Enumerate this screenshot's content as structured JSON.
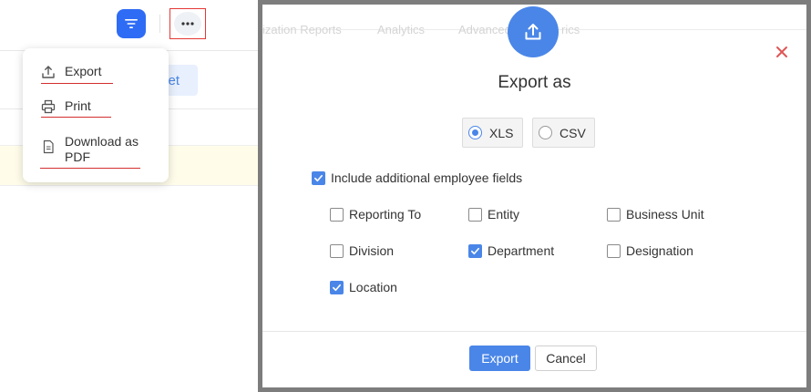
{
  "left_panel": {
    "background_button_label": "et",
    "menu": {
      "items": [
        {
          "label": "Export",
          "icon": "upload-icon"
        },
        {
          "label": "Print",
          "icon": "printer-icon"
        },
        {
          "label": "Download as PDF",
          "icon": "document-icon"
        }
      ]
    },
    "colors": {
      "filter_button": "#2f6cf5",
      "highlight_border": "#e53935",
      "underline": "#d32f2f"
    }
  },
  "dialog": {
    "background_tabs": [
      "ization Reports",
      "Analytics",
      "Advanced",
      "rics"
    ],
    "title": "Export as",
    "formats": [
      {
        "label": "XLS",
        "selected": true
      },
      {
        "label": "CSV",
        "selected": false
      }
    ],
    "include_fields": {
      "label": "Include additional employee fields",
      "checked": true
    },
    "fields": [
      {
        "label": "Reporting To",
        "checked": false
      },
      {
        "label": "Entity",
        "checked": false
      },
      {
        "label": "Business Unit",
        "checked": false
      },
      {
        "label": "Division",
        "checked": false
      },
      {
        "label": "Department",
        "checked": true
      },
      {
        "label": "Designation",
        "checked": false
      },
      {
        "label": "Location",
        "checked": true
      }
    ],
    "buttons": {
      "export": "Export",
      "cancel": "Cancel"
    },
    "colors": {
      "accent": "#4a86e8",
      "close": "#e05555"
    }
  }
}
